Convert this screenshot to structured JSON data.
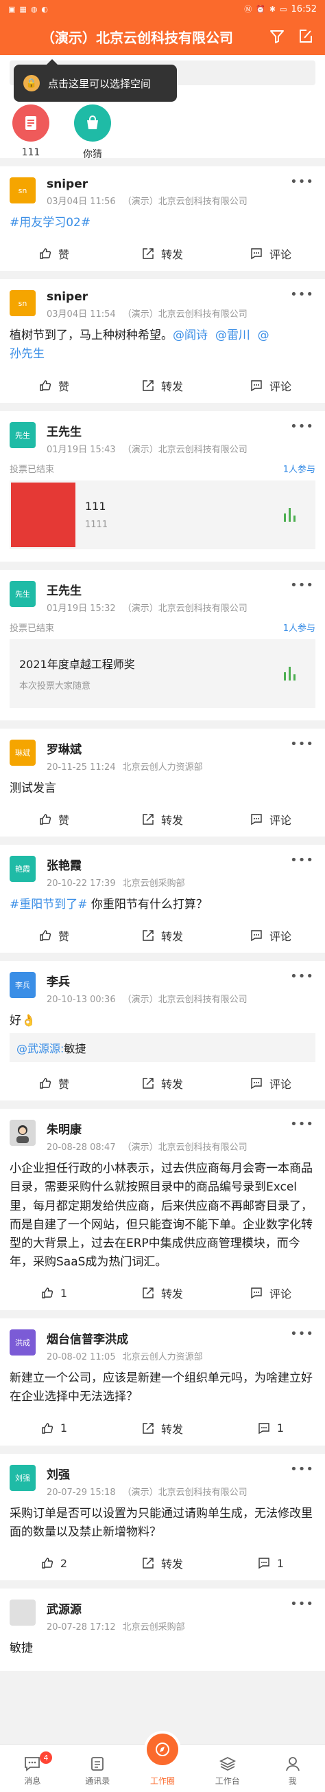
{
  "status": {
    "time": "16:52"
  },
  "header": {
    "title": "（演示）北京云创科技有限公司"
  },
  "tooltip": {
    "text": "点击这里可以选择空间"
  },
  "apps": [
    {
      "label": "111"
    },
    {
      "label": "你猜"
    }
  ],
  "colors": {
    "brand": "#fb6a2c",
    "link": "#3a8ee6"
  },
  "posts": [
    {
      "avatar": "sn",
      "avatar_color": "#f5a500",
      "name": "sniper",
      "date": "03月04日 11:56",
      "org": "（演示）北京云创科技有限公司",
      "text_link": "#用友学习02#",
      "like": "赞",
      "share": "转发",
      "comment": "评论"
    },
    {
      "avatar": "sn",
      "avatar_color": "#f5a500",
      "name": "sniper",
      "date": "03月04日 11:54",
      "org": "（演示）北京云创科技有限公司",
      "text": "植树节到了，马上种树种希望。",
      "mentions": [
        "@阎诗",
        "@雷川",
        "@"
      ],
      "mention_tail": "孙先生",
      "like": "赞",
      "share": "转发",
      "comment": "评论"
    },
    {
      "avatar": "先生",
      "avatar_color": "#1fbba6",
      "name": "王先生",
      "date": "01月19日 15:43",
      "org": "（演示）北京云创科技有限公司",
      "vote_status": "投票已结束",
      "vote_count": "1人参与",
      "vote_title": "111",
      "vote_desc": "1111"
    },
    {
      "avatar": "先生",
      "avatar_color": "#1fbba6",
      "name": "王先生",
      "date": "01月19日 15:32",
      "org": "（演示）北京云创科技有限公司",
      "vote_status": "投票已结束",
      "vote_count": "1人参与",
      "vote_title": "2021年度卓越工程师奖",
      "vote_desc": "本次投票大家随意"
    },
    {
      "avatar": "琳斌",
      "avatar_color": "#f5a500",
      "name": "罗琳斌",
      "date": "20-11-25 11:24",
      "org": "北京云创人力资源部",
      "text": "测试发言",
      "like": "赞",
      "share": "转发",
      "comment": "评论"
    },
    {
      "avatar": "艳霞",
      "avatar_color": "#1fbba6",
      "name": "张艳霞",
      "date": "20-10-22 17:39",
      "org": "北京云创采购部",
      "text_link": "#重阳节到了#",
      "text": " 你重阳节有什么打算？",
      "like": "赞",
      "share": "转发",
      "comment": "评论"
    },
    {
      "avatar": "李兵",
      "avatar_color": "#3a8ee6",
      "name": "李兵",
      "date": "20-10-13 00:36",
      "org": "（演示）北京云创科技有限公司",
      "text": "好👌",
      "mention_link": "@武源源:",
      "mention_text": " 敏捷",
      "like": "赞",
      "share": "转发",
      "comment": "评论"
    },
    {
      "avatar": "",
      "avatar_color": "#d9d9d9",
      "name": "朱明康",
      "date": "20-08-28 08:47",
      "org": "（演示）北京云创科技有限公司",
      "text": "小企业担任行政的小林表示，过去供应商每月会寄一本商品目录，需要采购什么就按照目录中的商品编号录到Excel里，每月都定期发给供应商，后来供应商不再邮寄目录了，而是自建了一个网站，但只能查询不能下单。企业数字化转型的大背景上，过去在ERP中集成供应商管理模块，而今年，采购SaaS成为热门词汇。",
      "like": "1",
      "share": "转发",
      "comment": "评论"
    },
    {
      "avatar": "洪成",
      "avatar_color": "#7b5bd6",
      "name": "烟台信普李洪成",
      "date": "20-08-02 11:05",
      "org": "北京云创人力资源部",
      "text": "新建立一个公司，应该是新建一个组织单元吗，为啥建立好在企业选择中无法选择？",
      "like": "1",
      "share": "转发",
      "comment": "1"
    },
    {
      "avatar": "刘强",
      "avatar_color": "#1fbba6",
      "name": "刘强",
      "date": "20-07-29 15:18",
      "org": "（演示）北京云创科技有限公司",
      "text": "采购订单是否可以设置为只能通过请购单生成，无法修改里面的数量以及禁止新增物料？",
      "like": "2",
      "share": "转发",
      "comment": "1"
    },
    {
      "avatar": "",
      "avatar_color": "#e0e0e0",
      "name": "武源源",
      "date": "20-07-28 17:12",
      "org": "北京云创采购部",
      "text": "敏捷"
    }
  ],
  "tabs": [
    {
      "label": "消息",
      "badge": "4"
    },
    {
      "label": "通讯录"
    },
    {
      "label": "工作圈"
    },
    {
      "label": "工作台"
    },
    {
      "label": "我"
    }
  ]
}
